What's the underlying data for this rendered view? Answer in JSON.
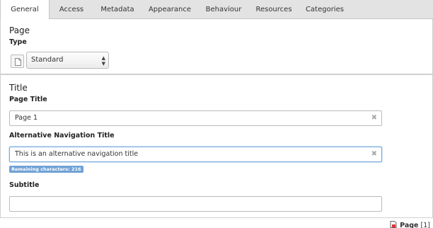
{
  "tabs": [
    {
      "label": "General",
      "active": true
    },
    {
      "label": "Access"
    },
    {
      "label": "Metadata"
    },
    {
      "label": "Appearance"
    },
    {
      "label": "Behaviour"
    },
    {
      "label": "Resources"
    },
    {
      "label": "Categories"
    }
  ],
  "page_section": {
    "heading": "Page",
    "type_label": "Type",
    "type_value": "Standard",
    "type_icon": "document-icon"
  },
  "title_section": {
    "heading": "Title",
    "page_title_label": "Page Title",
    "page_title_value": "Page 1",
    "alt_nav_label": "Alternative Navigation Title",
    "alt_nav_value": "This is an alternative navigation title",
    "remaining_chars": "Remaining characters: 216",
    "subtitle_label": "Subtitle",
    "subtitle_value": "",
    "clear_icon": "clear-icon"
  },
  "footer": {
    "record_type": "Page",
    "record_id": "[1]",
    "icon": "page-icon"
  },
  "colors": {
    "tab_bar": "#e3e3e3",
    "focus_border": "#6fa6d9",
    "badge": "#6fa2d6"
  }
}
